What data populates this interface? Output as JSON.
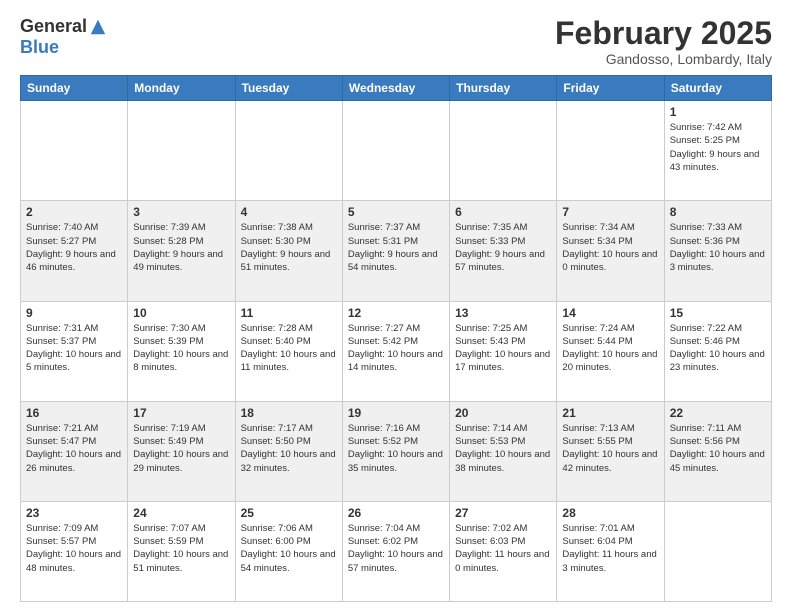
{
  "logo": {
    "general": "General",
    "blue": "Blue"
  },
  "title": "February 2025",
  "location": "Gandosso, Lombardy, Italy",
  "days_header": [
    "Sunday",
    "Monday",
    "Tuesday",
    "Wednesday",
    "Thursday",
    "Friday",
    "Saturday"
  ],
  "weeks": [
    {
      "shaded": false,
      "cells": [
        {
          "day": "",
          "text": ""
        },
        {
          "day": "",
          "text": ""
        },
        {
          "day": "",
          "text": ""
        },
        {
          "day": "",
          "text": ""
        },
        {
          "day": "",
          "text": ""
        },
        {
          "day": "",
          "text": ""
        },
        {
          "day": "1",
          "text": "Sunrise: 7:42 AM\nSunset: 5:25 PM\nDaylight: 9 hours and 43 minutes."
        }
      ]
    },
    {
      "shaded": true,
      "cells": [
        {
          "day": "2",
          "text": "Sunrise: 7:40 AM\nSunset: 5:27 PM\nDaylight: 9 hours and 46 minutes."
        },
        {
          "day": "3",
          "text": "Sunrise: 7:39 AM\nSunset: 5:28 PM\nDaylight: 9 hours and 49 minutes."
        },
        {
          "day": "4",
          "text": "Sunrise: 7:38 AM\nSunset: 5:30 PM\nDaylight: 9 hours and 51 minutes."
        },
        {
          "day": "5",
          "text": "Sunrise: 7:37 AM\nSunset: 5:31 PM\nDaylight: 9 hours and 54 minutes."
        },
        {
          "day": "6",
          "text": "Sunrise: 7:35 AM\nSunset: 5:33 PM\nDaylight: 9 hours and 57 minutes."
        },
        {
          "day": "7",
          "text": "Sunrise: 7:34 AM\nSunset: 5:34 PM\nDaylight: 10 hours and 0 minutes."
        },
        {
          "day": "8",
          "text": "Sunrise: 7:33 AM\nSunset: 5:36 PM\nDaylight: 10 hours and 3 minutes."
        }
      ]
    },
    {
      "shaded": false,
      "cells": [
        {
          "day": "9",
          "text": "Sunrise: 7:31 AM\nSunset: 5:37 PM\nDaylight: 10 hours and 5 minutes."
        },
        {
          "day": "10",
          "text": "Sunrise: 7:30 AM\nSunset: 5:39 PM\nDaylight: 10 hours and 8 minutes."
        },
        {
          "day": "11",
          "text": "Sunrise: 7:28 AM\nSunset: 5:40 PM\nDaylight: 10 hours and 11 minutes."
        },
        {
          "day": "12",
          "text": "Sunrise: 7:27 AM\nSunset: 5:42 PM\nDaylight: 10 hours and 14 minutes."
        },
        {
          "day": "13",
          "text": "Sunrise: 7:25 AM\nSunset: 5:43 PM\nDaylight: 10 hours and 17 minutes."
        },
        {
          "day": "14",
          "text": "Sunrise: 7:24 AM\nSunset: 5:44 PM\nDaylight: 10 hours and 20 minutes."
        },
        {
          "day": "15",
          "text": "Sunrise: 7:22 AM\nSunset: 5:46 PM\nDaylight: 10 hours and 23 minutes."
        }
      ]
    },
    {
      "shaded": true,
      "cells": [
        {
          "day": "16",
          "text": "Sunrise: 7:21 AM\nSunset: 5:47 PM\nDaylight: 10 hours and 26 minutes."
        },
        {
          "day": "17",
          "text": "Sunrise: 7:19 AM\nSunset: 5:49 PM\nDaylight: 10 hours and 29 minutes."
        },
        {
          "day": "18",
          "text": "Sunrise: 7:17 AM\nSunset: 5:50 PM\nDaylight: 10 hours and 32 minutes."
        },
        {
          "day": "19",
          "text": "Sunrise: 7:16 AM\nSunset: 5:52 PM\nDaylight: 10 hours and 35 minutes."
        },
        {
          "day": "20",
          "text": "Sunrise: 7:14 AM\nSunset: 5:53 PM\nDaylight: 10 hours and 38 minutes."
        },
        {
          "day": "21",
          "text": "Sunrise: 7:13 AM\nSunset: 5:55 PM\nDaylight: 10 hours and 42 minutes."
        },
        {
          "day": "22",
          "text": "Sunrise: 7:11 AM\nSunset: 5:56 PM\nDaylight: 10 hours and 45 minutes."
        }
      ]
    },
    {
      "shaded": false,
      "cells": [
        {
          "day": "23",
          "text": "Sunrise: 7:09 AM\nSunset: 5:57 PM\nDaylight: 10 hours and 48 minutes."
        },
        {
          "day": "24",
          "text": "Sunrise: 7:07 AM\nSunset: 5:59 PM\nDaylight: 10 hours and 51 minutes."
        },
        {
          "day": "25",
          "text": "Sunrise: 7:06 AM\nSunset: 6:00 PM\nDaylight: 10 hours and 54 minutes."
        },
        {
          "day": "26",
          "text": "Sunrise: 7:04 AM\nSunset: 6:02 PM\nDaylight: 10 hours and 57 minutes."
        },
        {
          "day": "27",
          "text": "Sunrise: 7:02 AM\nSunset: 6:03 PM\nDaylight: 11 hours and 0 minutes."
        },
        {
          "day": "28",
          "text": "Sunrise: 7:01 AM\nSunset: 6:04 PM\nDaylight: 11 hours and 3 minutes."
        },
        {
          "day": "",
          "text": ""
        }
      ]
    }
  ]
}
